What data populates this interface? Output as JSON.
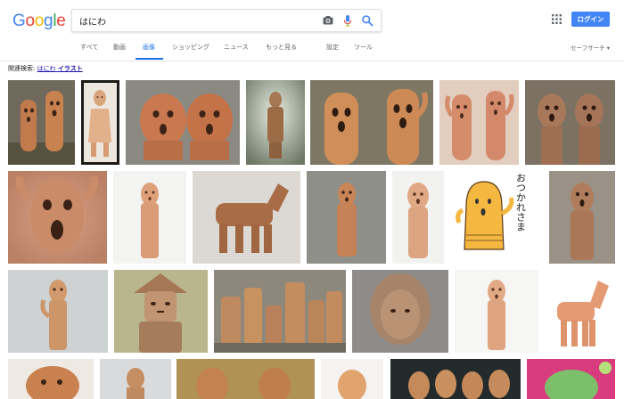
{
  "header": {
    "logo": {
      "letters": [
        "G",
        "o",
        "o",
        "g",
        "l",
        "e"
      ],
      "colors": [
        "#4285f4",
        "#ea4335",
        "#fbbc05",
        "#4285f4",
        "#34a853",
        "#ea4335"
      ]
    },
    "search_value": "はにわ",
    "login_label": "ログイン",
    "tabs": [
      {
        "label": "すべて",
        "active": false
      },
      {
        "label": "動画",
        "active": false
      },
      {
        "label": "画像",
        "active": true
      },
      {
        "label": "ショッピング",
        "active": false
      },
      {
        "label": "ニュース",
        "active": false
      },
      {
        "label": "もっと見る",
        "active": false
      },
      {
        "label": "設定",
        "active": false
      },
      {
        "label": "ツール",
        "active": false
      }
    ],
    "safesearch": "セーフサーチ ▾"
  },
  "related": {
    "prefix": "関連検索:",
    "link_term": "はにわ",
    "link_bold": "イラスト"
  },
  "images": {
    "illustration_text": "おつかれさま",
    "rows": [
      {
        "count": 8,
        "subjects": [
          "two haniwa figures",
          "haniwa dancer doll",
          "two haniwa faces",
          "haniwa warrior",
          "two tall haniwa",
          "two haniwa dancers",
          "two haniwa figures",
          ""
        ]
      },
      {
        "count": 7,
        "subjects": [
          "haniwa face close-up",
          "haniwa figure",
          "haniwa horse",
          "haniwa figure",
          "haniwa figure",
          "haniwa illustration",
          "haniwa figure"
        ]
      },
      {
        "count": 6,
        "subjects": [
          "haniwa figure",
          "haniwa warrior with hat",
          "haniwa group",
          "haniwa hooded head",
          "haniwa figure",
          "haniwa horse"
        ]
      }
    ]
  },
  "colors": {
    "accent": "#1a73e8",
    "login_bg": "#4285f4",
    "link": "#1a0dab"
  }
}
